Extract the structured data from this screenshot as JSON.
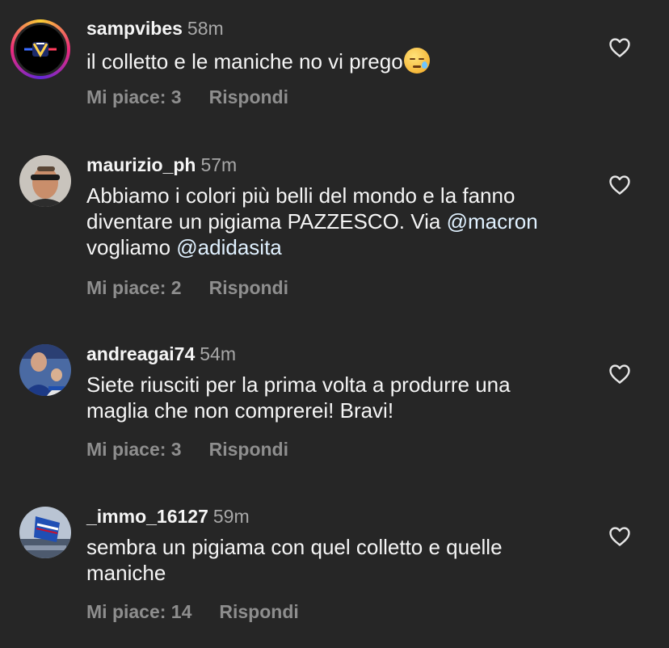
{
  "colors": {
    "background": "#262626",
    "text": "#f5f5f5",
    "muted": "#8e8e8e",
    "mention": "#e0f1ff"
  },
  "comments": [
    {
      "username": "sampvibes",
      "time": "58m",
      "text": "il colletto e le maniche no vi prego",
      "emoji_icon": "sleepy-face-icon",
      "likes": "Mi piace: 3",
      "reply": "Rispondi"
    },
    {
      "username": "maurizio_ph",
      "time": "57m",
      "text_line1": "Abbiamo i colori più belli del mondo e la fanno",
      "text_line2_part1": "diventare un pigiama PAZZESCO. Via ",
      "mention1": "@macron",
      "text_line3_part1": "vogliamo ",
      "mention2": "@adidasita",
      "likes": "Mi piace: 2",
      "reply": "Rispondi"
    },
    {
      "username": "andreagai74",
      "time": "54m",
      "text_line1": "Siete riusciti per la prima volta a produrre una",
      "text_line2": "maglia che non comprerei! Bravi!",
      "likes": "Mi piace: 3",
      "reply": "Rispondi"
    },
    {
      "username": "_immo_16127",
      "time": "59m",
      "text_line1": "sembra un pigiama con quel colletto e quelle",
      "text_line2": "maniche",
      "likes": "Mi piace: 14",
      "reply": "Rispondi"
    }
  ]
}
